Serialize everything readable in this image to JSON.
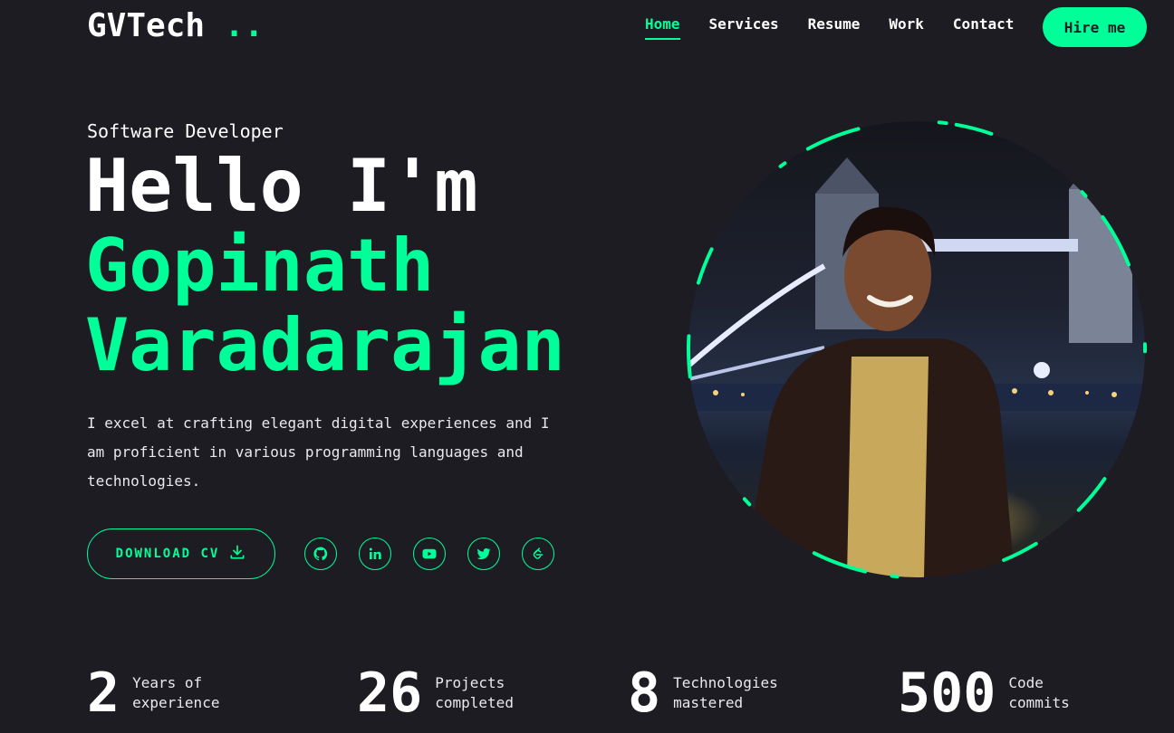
{
  "header": {
    "logo_text": "GVTech",
    "logo_dots": "..",
    "nav": [
      {
        "label": "Home",
        "active": true
      },
      {
        "label": "Services",
        "active": false
      },
      {
        "label": "Resume",
        "active": false
      },
      {
        "label": "Work",
        "active": false
      },
      {
        "label": "Contact",
        "active": false
      }
    ],
    "hire_label": "Hire me"
  },
  "hero": {
    "role": "Software Developer",
    "greeting": "Hello I'm",
    "name_line1": "Gopinath",
    "name_line2": "Varadarajan",
    "description": "I excel at crafting elegant digital experiences and I am proficient in various programming languages and technologies.",
    "download_label": "DOWNLOAD CV",
    "socials": [
      "github-icon",
      "linkedin-icon",
      "youtube-icon",
      "twitter-icon",
      "leetcode-icon"
    ]
  },
  "stats": [
    {
      "value": "2",
      "label": "Years of experience"
    },
    {
      "value": "26",
      "label": "Projects completed"
    },
    {
      "value": "8",
      "label": "Technologies mastered"
    },
    {
      "value": "500",
      "label": "Code commits"
    }
  ],
  "colors": {
    "background": "#1c1c22",
    "accent": "#00ff99",
    "text": "#ffffff"
  }
}
